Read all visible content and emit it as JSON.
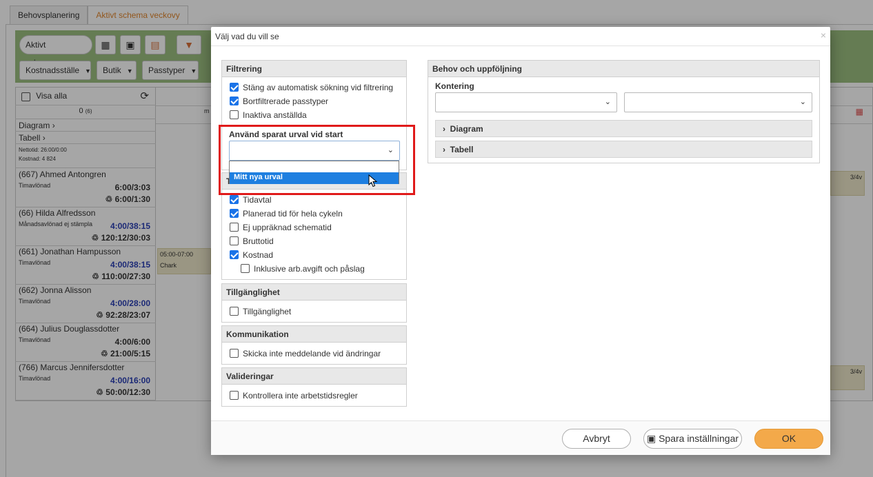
{
  "app": {
    "tabs": [
      "Behovsplanering",
      "Aktivt schema veckovy"
    ],
    "toolbar": {
      "active_schema": "Aktivt schema",
      "cost_center": "Kostnadsställe",
      "store": "Butik",
      "shift_types": "Passtyper"
    },
    "left": {
      "show_all": "Visa alla",
      "count": "0",
      "count_sub": "(6)",
      "diagram": "Diagram",
      "table": "Tabell",
      "net_time": "Nettotid: 26:00/0:00",
      "cost": "Kostnad: 4 824"
    },
    "header_day": "m",
    "employees": [
      {
        "name": "(667) Ahmed Antongren",
        "type": "Timavlönad",
        "v1": "6:00/3:03",
        "v2": "6:00/1:30",
        "v1_blue": false
      },
      {
        "name": "(66) Hilda Alfredsson",
        "type": "Månadsavlönad ej stämpla",
        "v1": "4:00/38:15",
        "v2": "120:12/30:03",
        "v1_blue": true
      },
      {
        "name": "(661) Jonathan Hampusson",
        "type": "Timavlönad",
        "v1": "4:00/38:15",
        "v2": "110:00/27:30",
        "v1_blue": true
      },
      {
        "name": "(662) Jonna Alisson",
        "type": "Timavlönad",
        "v1": "4:00/28:00",
        "v2": "92:28/23:07",
        "v1_blue": true
      },
      {
        "name": "(664) Julius Douglassdotter",
        "type": "Timavlönad",
        "v1": "4:00/6:00",
        "v2": "21:00/5:15",
        "v1_blue": false
      },
      {
        "name": "(766) Marcus Jennifersdotter",
        "type": "Timavlönad",
        "v1": "4:00/16:00",
        "v2": "50:00/12:30",
        "v1_blue": true
      }
    ],
    "shift": {
      "time": "05:00-07:00",
      "dept": "Chark"
    },
    "badge_a": "3/4v",
    "badge_b": "3/4v"
  },
  "modal": {
    "title": "Välj vad du vill se",
    "close": "×",
    "filtering": {
      "title": "Filtrering",
      "options": [
        {
          "label": "Stäng av automatisk sökning vid filtrering",
          "checked": true
        },
        {
          "label": "Bortfiltrerade passtyper",
          "checked": true
        },
        {
          "label": "Inaktiva anställda",
          "checked": false
        }
      ],
      "saved_selection_label": "Använd sparat urval vid start",
      "dropdown_option": "Mitt nya urval"
    },
    "time": {
      "title_partial": "T",
      "options": [
        {
          "label": "Tidavtal",
          "checked": true
        },
        {
          "label": "Planerad tid för hela cykeln",
          "checked": true
        },
        {
          "label": "Ej uppräknad schematid",
          "checked": false
        },
        {
          "label": "Bruttotid",
          "checked": false
        },
        {
          "label": "Kostnad",
          "checked": true
        }
      ],
      "sub_option": {
        "label": "Inklusive arb.avgift och påslag",
        "checked": false
      }
    },
    "availability": {
      "title": "Tillgänglighet",
      "option": "Tillgänglighet"
    },
    "communication": {
      "title": "Kommunikation",
      "option": "Skicka inte meddelande vid ändringar"
    },
    "validation": {
      "title": "Valideringar",
      "option": "Kontrollera inte arbetstidsregler"
    },
    "needs": {
      "title": "Behov och uppföljning",
      "kontering": "Kontering",
      "diagram": "Diagram",
      "table": "Tabell"
    },
    "footer": {
      "cancel": "Avbryt",
      "save": "Spara inställningar",
      "ok": "OK"
    }
  }
}
